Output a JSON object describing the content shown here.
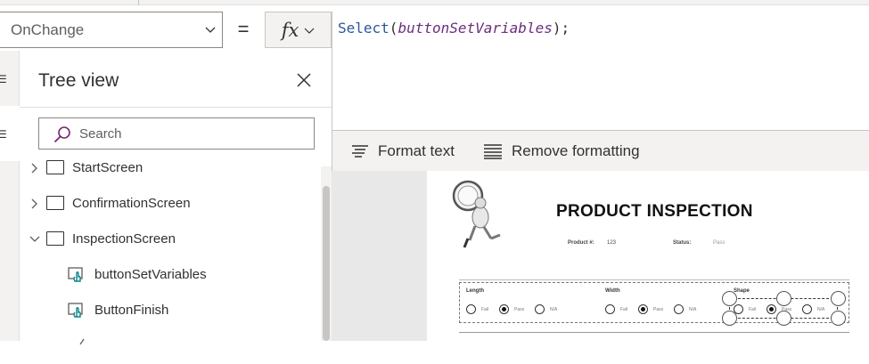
{
  "formula_bar": {
    "property": "OnChange",
    "equals": "=",
    "fx_label": "fx",
    "formula": {
      "function": "Select",
      "open": "(",
      "argument": "buttonSetVariables",
      "close": ");"
    }
  },
  "format_bar": {
    "format_text": "Format text",
    "remove_formatting": "Remove formatting"
  },
  "tree_view": {
    "title": "Tree view",
    "search_placeholder": "Search",
    "items": [
      {
        "label": "StartScreen",
        "expanded": false
      },
      {
        "label": "ConfirmationScreen",
        "expanded": false
      },
      {
        "label": "InspectionScreen",
        "expanded": true
      },
      {
        "label": "buttonSetVariables"
      },
      {
        "label": "ButtonFinish"
      }
    ]
  },
  "canvas": {
    "title": "PRODUCT INSPECTION",
    "product_label": "Product #:",
    "product_value": "123",
    "status_label": "Status:",
    "status_value": "Pass",
    "fields": [
      {
        "label": "Length",
        "options": [
          "Fail",
          "Pass",
          "N/A"
        ],
        "selected": "Pass"
      },
      {
        "label": "Width",
        "options": [
          "Fail",
          "Pass",
          "N/A"
        ],
        "selected": "Pass"
      },
      {
        "label": "Shape",
        "options": [
          "Fail",
          "Pass",
          "N/A"
        ],
        "selected": "Pass"
      }
    ]
  },
  "colors": {
    "accent": "#742774",
    "formula_function": "#2b579a",
    "formula_argument": "#6b2e7e",
    "button_icon_teal": "#038387"
  },
  "icons": [
    "chevron-down-icon",
    "fx-icon",
    "close-icon",
    "search-icon",
    "format-text-icon",
    "remove-formatting-icon",
    "screen-icon",
    "button-icon"
  ]
}
